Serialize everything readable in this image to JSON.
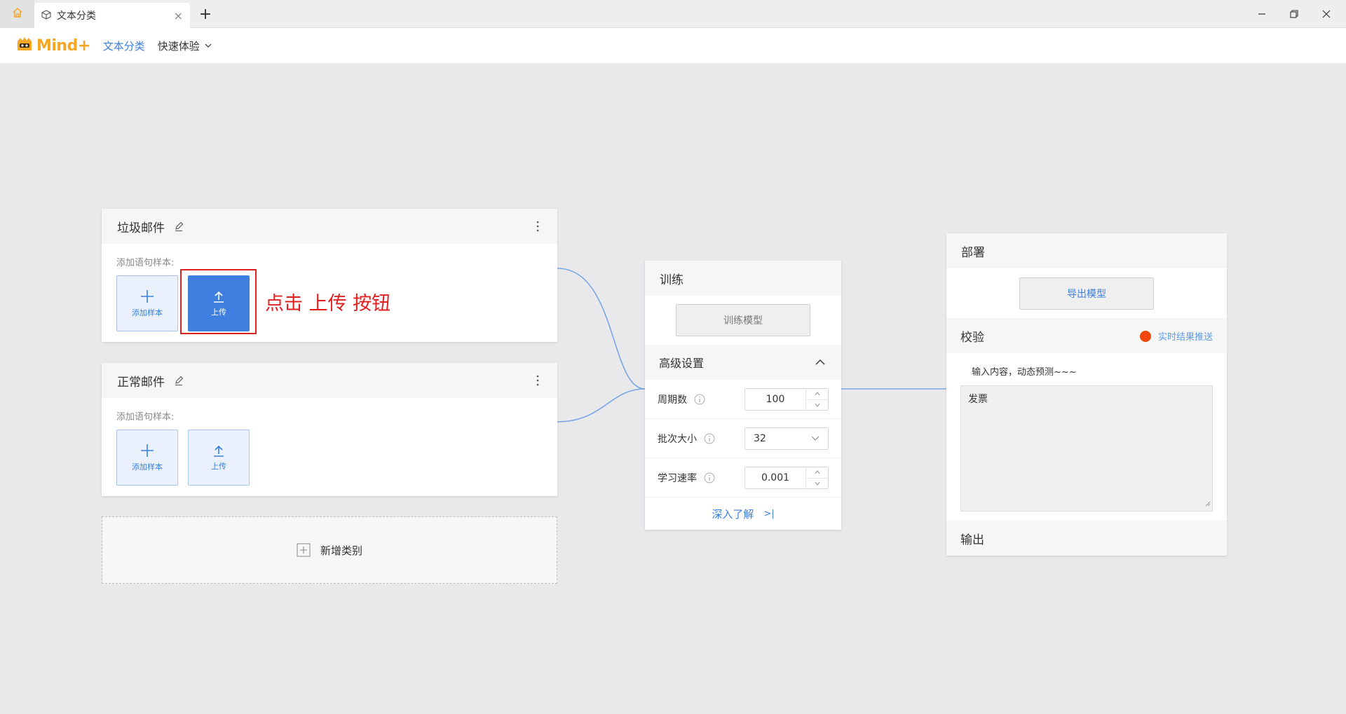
{
  "window": {
    "tab_title": "文本分类",
    "new_tab_symbol": "+",
    "tab_close_symbol": "×"
  },
  "menubar": {
    "logo_text": "Mind+",
    "active_item": "文本分类",
    "dropdown_item": "快速体验"
  },
  "categories": [
    {
      "title": "垃圾邮件",
      "subtitle": "添加语句样本:",
      "add_sample_label": "添加样本",
      "upload_label": "上传",
      "upload_highlighted": true
    },
    {
      "title": "正常邮件",
      "subtitle": "添加语句样本:",
      "add_sample_label": "添加样本",
      "upload_label": "上传",
      "upload_highlighted": false
    }
  ],
  "add_category_label": "新增类别",
  "annotation": "点击  上传  按钮",
  "train": {
    "title": "训练",
    "train_button": "训练模型",
    "advanced_title": "高级设置",
    "params": [
      {
        "label": "周期数",
        "value": "100",
        "kind": "stepper"
      },
      {
        "label": "批次大小",
        "value": "32",
        "kind": "select"
      },
      {
        "label": "学习速率",
        "value": "0.001",
        "kind": "stepper"
      }
    ],
    "learn_more": "深入了解",
    "learn_more_arrow": ">|"
  },
  "deploy": {
    "title": "部署",
    "export_button": "导出模型",
    "verify_title": "校验",
    "push_label": "实时结果推送",
    "push_dot_color": "#f2470d",
    "verify_hint": "输入内容，动态预测~~~",
    "verify_input": "发票",
    "output_title": "输出"
  },
  "colors": {
    "accent": "#3a7fe0",
    "annotation": "#e02020",
    "logo": "#f5a623"
  }
}
